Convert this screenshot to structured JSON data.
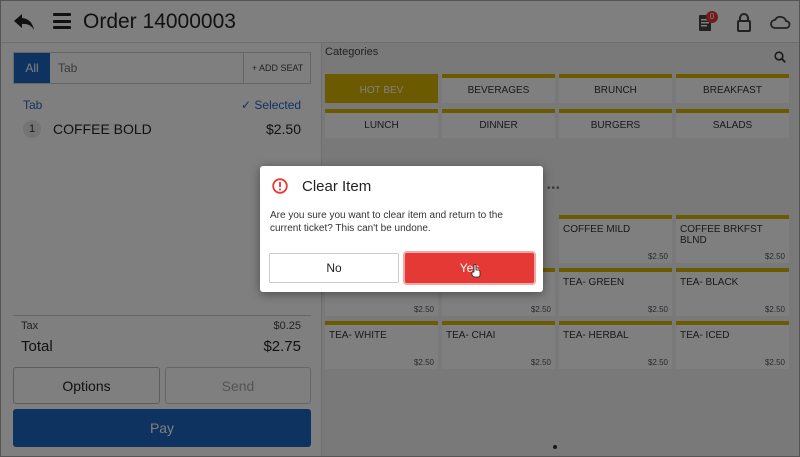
{
  "header": {
    "title": "Order 14000003",
    "ticket_badge": "0",
    "back_icon": "back-arrow-icon",
    "menu_icon": "hamburger-menu-icon",
    "ticket_icon": "ticket-icon",
    "lock_icon": "lock-icon",
    "cloud_icon": "cloud-icon"
  },
  "order_panel": {
    "tab_all_label": "All",
    "tab_input_placeholder": "Tab",
    "add_seat_label": "+ ADD SEAT",
    "tab_label": "Tab",
    "selected_label": "✓ Selected",
    "items": [
      {
        "qty": "1",
        "name": "COFFEE BOLD",
        "price": "$2.50"
      }
    ],
    "tax_label": "Tax",
    "tax_value": "$0.25",
    "total_label": "Total",
    "total_value": "$2.75",
    "options_label": "Options",
    "send_label": "Send",
    "pay_label": "Pay"
  },
  "menu_panel": {
    "categories_title": "Categories",
    "categories": [
      {
        "label": "HOT BEV",
        "active": true
      },
      {
        "label": "BEVERAGES"
      },
      {
        "label": "BRUNCH"
      },
      {
        "label": "BREAKFAST"
      },
      {
        "label": "LUNCH"
      },
      {
        "label": "DINNER"
      },
      {
        "label": "BURGERS"
      },
      {
        "label": "SALADS"
      }
    ],
    "products": [
      {
        "name": "COFFEE MILD",
        "price": "$2.50"
      },
      {
        "name": "COFFEE BRKFST BLND",
        "price": "$2.50"
      },
      {
        "name": "",
        "price": "$2.50"
      },
      {
        "name": "",
        "price": "$2.50"
      },
      {
        "name": "TEA- GREEN",
        "price": "$2.50"
      },
      {
        "name": "TEA- BLACK",
        "price": "$2.50"
      },
      {
        "name": "TEA- WHITE",
        "price": "$2.50"
      },
      {
        "name": "TEA- CHAI",
        "price": "$2.50"
      },
      {
        "name": "TEA- HERBAL",
        "price": "$2.50"
      },
      {
        "name": "TEA- ICED",
        "price": "$2.50"
      }
    ]
  },
  "dialog": {
    "title": "Clear Item",
    "message": "Are you sure you want to clear item and return to the current ticket? This can't be undone.",
    "no_label": "No",
    "yes_label": "Yes"
  },
  "colors": {
    "primary_blue": "#1f66c1",
    "category_gold": "#d8b400",
    "danger_red": "#e53935"
  }
}
